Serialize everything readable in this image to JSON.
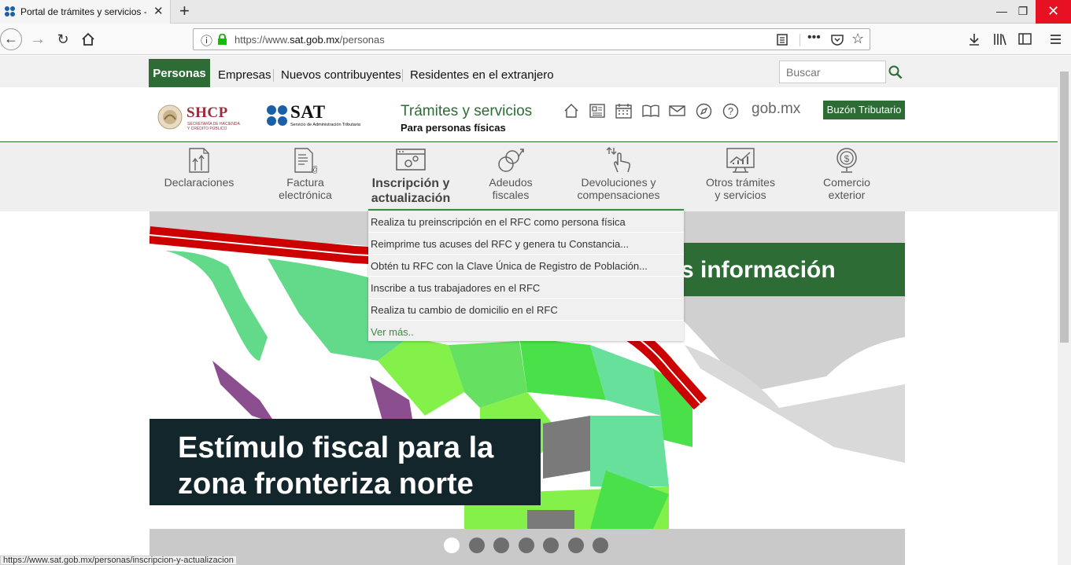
{
  "browser": {
    "tab_title": "Portal de trámites y servicios - S",
    "tab_close": "✕",
    "new_tab": "+",
    "url_prefix": "https://www.",
    "url_host": "sat.gob.mx",
    "url_path": "/personas",
    "win_min": "—",
    "win_max": "❐",
    "win_close": "✕"
  },
  "topnav": {
    "active": "Personas",
    "items": [
      "Empresas",
      "Nuevos contribuyentes",
      "Residentes en el extranjero"
    ],
    "search_placeholder": "Buscar"
  },
  "header": {
    "shcp_title": "SHCP",
    "shcp_sub1": "SECRETARÍA DE HACIENDA",
    "shcp_sub2": "Y CRÉDITO PÚBLICO",
    "sat_title": "SAT",
    "sat_sub": "Servicio de Administración Tributaria",
    "tramites_title": "Trámites y servicios",
    "tramites_sub": "Para personas físicas",
    "gobmx": "gob.mx",
    "buzon": "Buzón Tributario"
  },
  "menu": [
    {
      "line1": "Declaraciones",
      "line2": ""
    },
    {
      "line1": "Factura",
      "line2": "electrónica"
    },
    {
      "line1": "Inscripción y",
      "line2": "actualización"
    },
    {
      "line1": "Adeudos",
      "line2": "fiscales"
    },
    {
      "line1": "Devoluciones y",
      "line2": "compensaciones"
    },
    {
      "line1": "Otros trámites",
      "line2": "y servicios"
    },
    {
      "line1": "Comercio",
      "line2": "exterior"
    }
  ],
  "dropdown": [
    "Realiza tu preinscripción en el RFC como persona física",
    "Reimprime tus acuses del RFC y genera tu Constancia...",
    "Obtén tu RFC con la Clave Única de Registro de Población...",
    "Inscribe a tus trabajadores en el RFC",
    "Realiza tu cambio de domicilio en el RFC",
    "Ver más.."
  ],
  "hero": {
    "banner_text": "s información",
    "title_line1": "Estímulo fiscal para la",
    "title_line2": "zona fronteriza norte",
    "slides_total": 7,
    "slide_active": 1
  },
  "status_url": "https://www.sat.gob.mx/personas/inscripcion-y-actualizacion",
  "colors": {
    "gob_green": "#2d6c35",
    "banner_green": "#2d6c35",
    "hero_dark": "#12262b",
    "border_red": "#cc0000",
    "close_red": "#e81123"
  }
}
